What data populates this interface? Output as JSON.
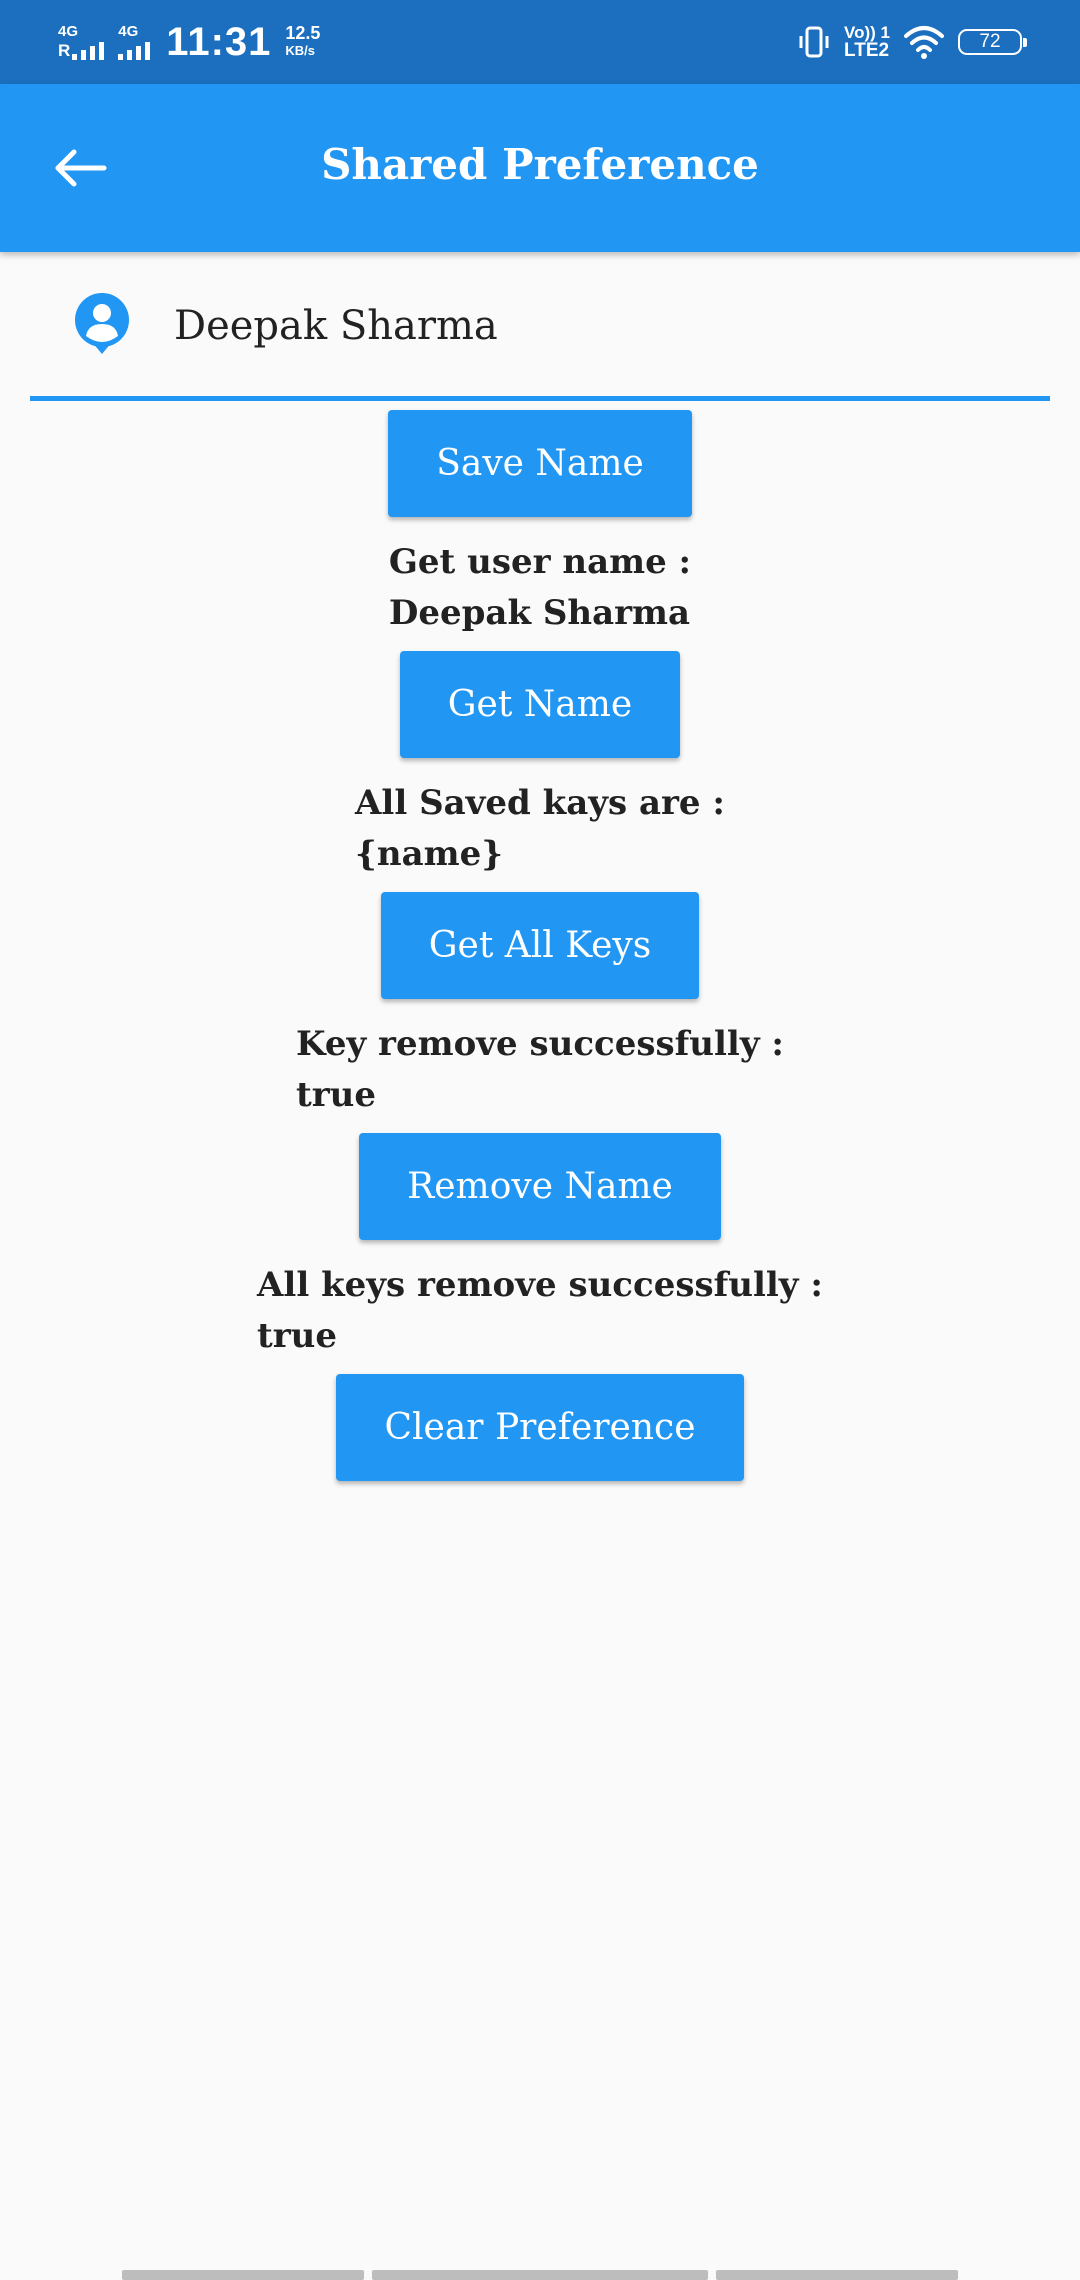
{
  "status_bar": {
    "net1_type": "4G",
    "net1_roaming": "R",
    "net2_type": "4G",
    "time": "11:31",
    "speed_value": "12.5",
    "speed_unit": "KB/s",
    "volte_line1": "Vo)) 1",
    "volte_line2": "LTE2",
    "battery": "72"
  },
  "app_bar": {
    "title": "Shared Preference",
    "back_icon": "arrow-back-icon"
  },
  "name_field": {
    "icon": "person-pin-icon",
    "value": "Deepak Sharma"
  },
  "actions": {
    "save_label": "Save Name",
    "get_result": "Get user name :\nDeepak Sharma",
    "get_label": "Get Name",
    "keys_result": "All Saved kays are :\n{name}",
    "keys_label": "Get All Keys",
    "remove_result": "Key remove successfully :\ntrue",
    "remove_label": "Remove Name",
    "clear_result": "All keys remove successfully :\ntrue",
    "clear_label": "Clear Preference"
  },
  "colors": {
    "status_bar": "#1c6fbf",
    "primary": "#2196f3",
    "background": "#fafafa"
  }
}
